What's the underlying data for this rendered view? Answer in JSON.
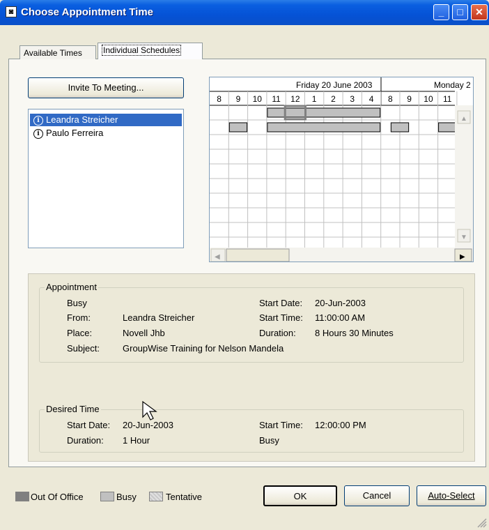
{
  "window": {
    "title": "Choose Appointment Time",
    "icon_name": "app-icon",
    "minimize": "_",
    "maximize": "□",
    "close": "✕"
  },
  "tabs": [
    {
      "label": "Available Times",
      "active": false
    },
    {
      "label": "Individual Schedules",
      "active": true
    }
  ],
  "invite_button": "Invite To Meeting...",
  "participants": [
    {
      "name": "Leandra Streicher",
      "selected": true,
      "icon": "info-icon"
    },
    {
      "name": "Paulo Ferreira",
      "selected": false,
      "icon": "info-icon"
    }
  ],
  "schedule": {
    "days": [
      {
        "label": "Friday 20 June 2003"
      },
      {
        "label": "Monday 2"
      }
    ],
    "hours_day1": [
      "8",
      "9",
      "10",
      "11",
      "12",
      "1",
      "2",
      "3",
      "4"
    ],
    "hours_day2": [
      "8",
      "9",
      "10",
      "11"
    ],
    "busy_blocks": [
      {
        "row": 0,
        "from": 3.0,
        "to": 9.0
      },
      {
        "row": 1,
        "from": 1.0,
        "to": 2.0
      },
      {
        "row": 1,
        "from": 3.0,
        "to": 9.0
      },
      {
        "row": 1,
        "from": 9.5,
        "to": 10.5
      },
      {
        "row": 1,
        "from": 12.0,
        "to": 13.0
      }
    ],
    "busy_color": "#c0c0c0",
    "selection_color": "#808080"
  },
  "appointment": {
    "group_label": "Appointment",
    "status": "Busy",
    "from_label": "From:",
    "from_value": "Leandra Streicher",
    "place_label": "Place:",
    "place_value": "Novell Jhb",
    "subject_label": "Subject:",
    "subject_value": "GroupWise Training for Nelson Mandela",
    "start_date_label": "Start Date:",
    "start_date_value": "20-Jun-2003",
    "start_time_label": "Start Time:",
    "start_time_value": "11:00:00 AM",
    "duration_label": "Duration:",
    "duration_value": "8 Hours 30 Minutes"
  },
  "desired": {
    "group_label": "Desired Time",
    "start_date_label": "Start Date:",
    "start_date_value": "20-Jun-2003",
    "duration_label": "Duration:",
    "duration_value": "1 Hour",
    "start_time_label": "Start Time:",
    "start_time_value": "12:00:00 PM",
    "status": "Busy"
  },
  "legend": {
    "out_of_office": "Out Of Office",
    "out_of_office_color": "#808080",
    "busy": "Busy",
    "busy_color": "#c0c0c0",
    "tentative": "Tentative",
    "tentative_color": "#d8d8d8"
  },
  "buttons": {
    "ok": "OK",
    "cancel": "Cancel",
    "auto_select": "Auto-Select"
  }
}
